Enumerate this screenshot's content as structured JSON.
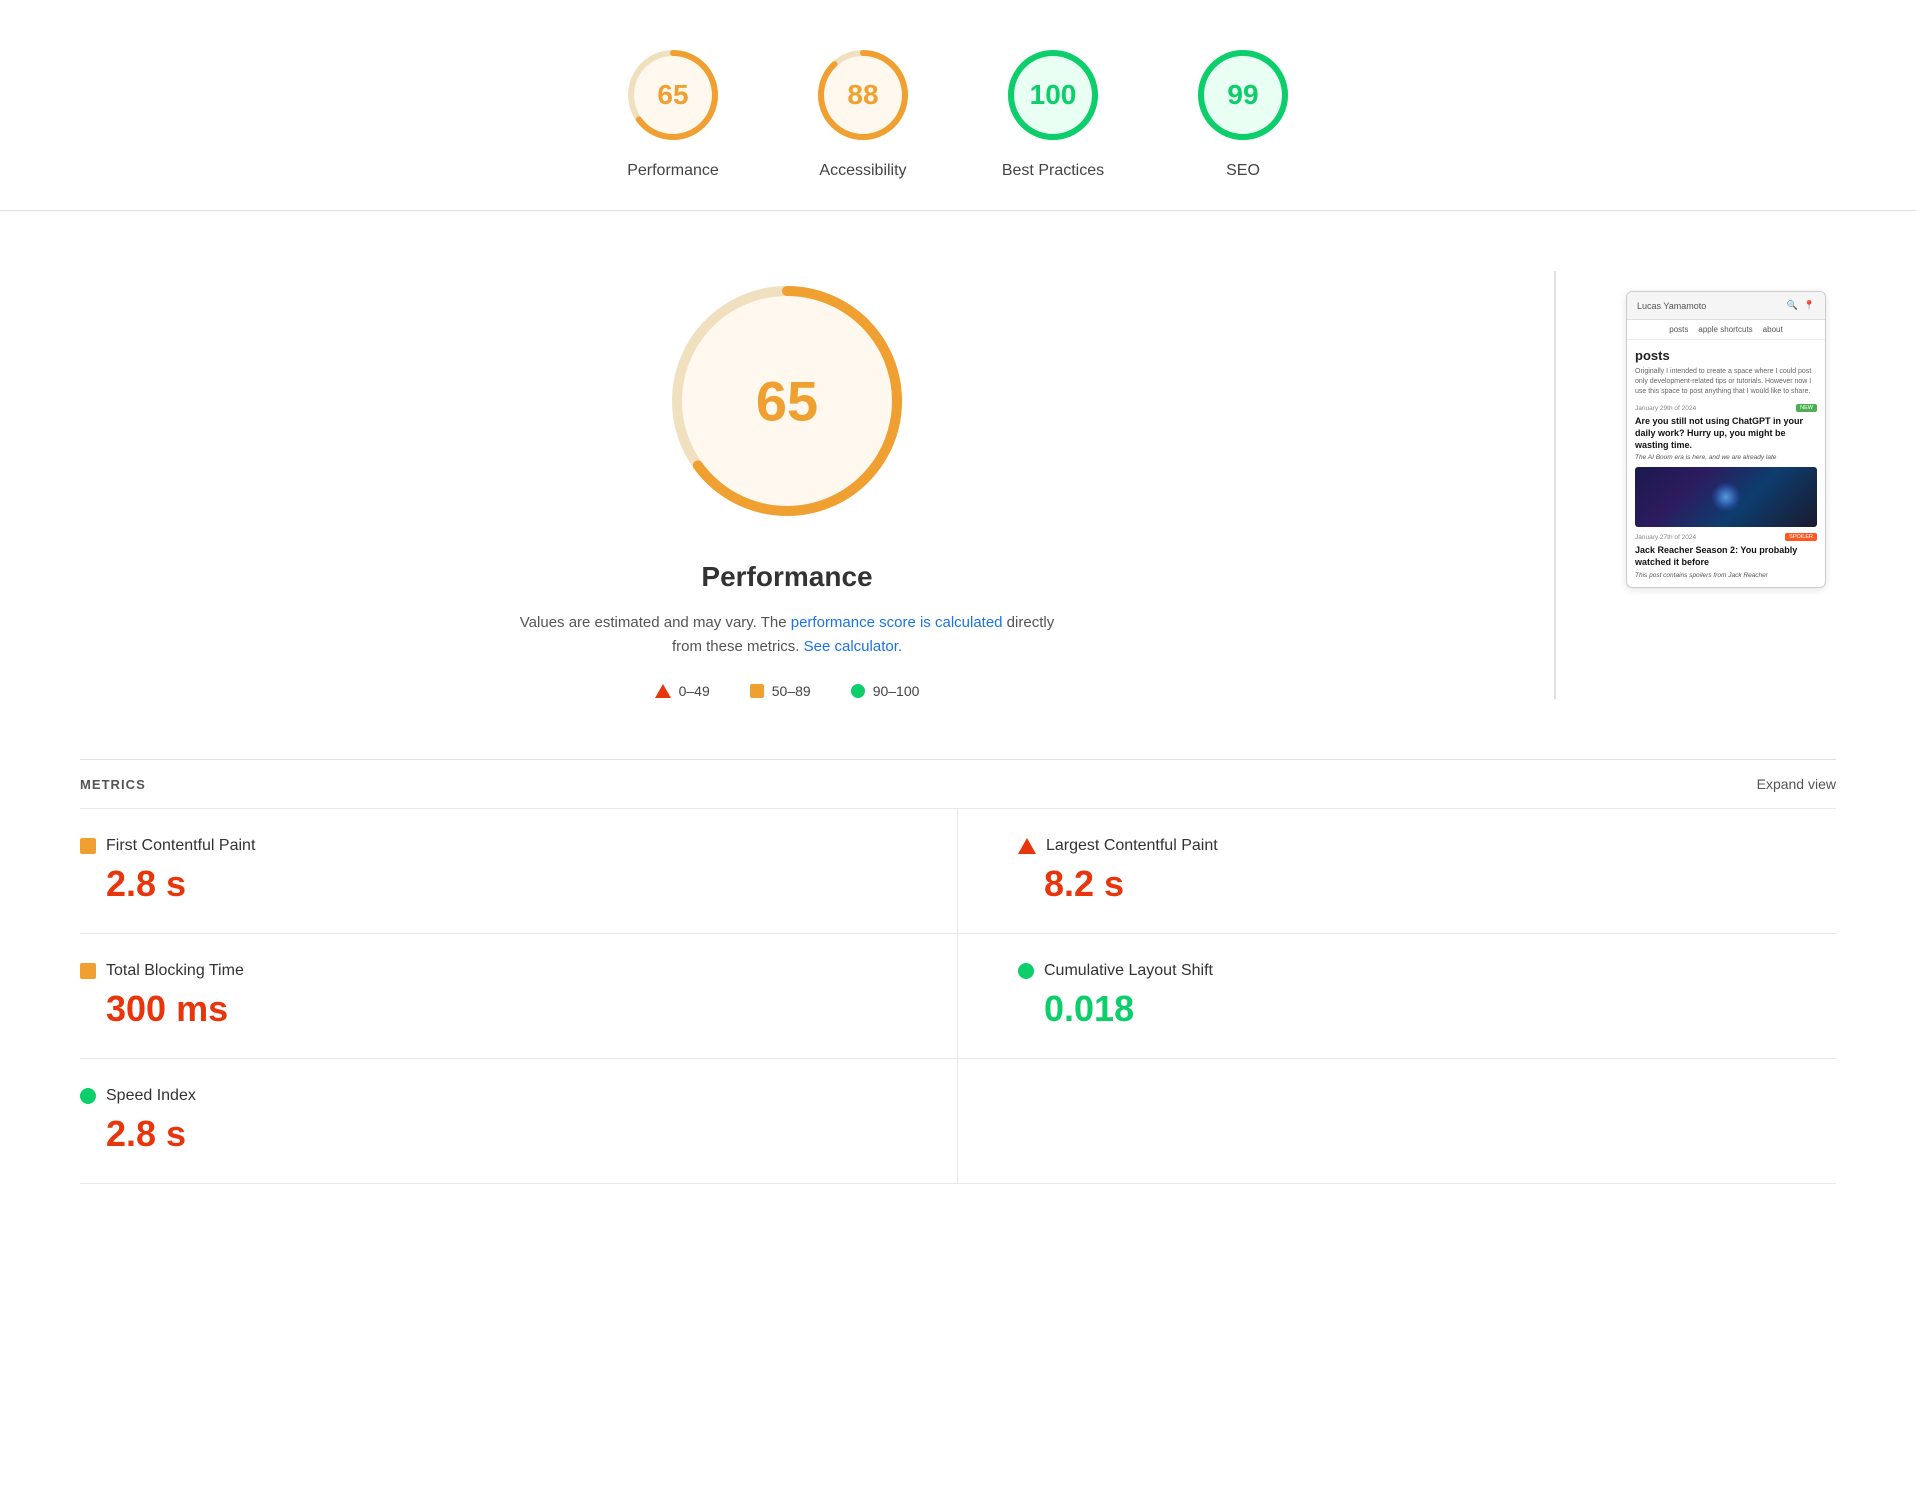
{
  "scores": [
    {
      "id": "performance",
      "value": 65,
      "label": "Performance",
      "color": "#f0a030",
      "ringColor": "#f0a030",
      "bgColor": "#fff8ee",
      "radius": 42,
      "circumference": 263.9,
      "dashOffset": 92.4
    },
    {
      "id": "accessibility",
      "value": 88,
      "label": "Accessibility",
      "color": "#f0a030",
      "ringColor": "#f0a030",
      "bgColor": "#fff8ee",
      "radius": 42,
      "circumference": 263.9,
      "dashOffset": 31.7
    },
    {
      "id": "best-practices",
      "value": 100,
      "label": "Best Practices",
      "color": "#0cce6b",
      "ringColor": "#0cce6b",
      "bgColor": "#eafff3",
      "radius": 42,
      "circumference": 263.9,
      "dashOffset": 0
    },
    {
      "id": "seo",
      "value": 99,
      "label": "SEO",
      "color": "#0cce6b",
      "ringColor": "#0cce6b",
      "bgColor": "#eafff3",
      "radius": 42,
      "circumference": 263.9,
      "dashOffset": 2.6
    }
  ],
  "big_score": {
    "value": "65",
    "title": "Performance",
    "desc_prefix": "Values are estimated and may vary. The ",
    "desc_link1": "performance score is calculated",
    "desc_middle": " directly from these metrics. ",
    "desc_link2": "See calculator.",
    "radius": 110,
    "circumference": 691.2,
    "dashOffset": 241.9
  },
  "legend": [
    {
      "type": "triangle",
      "range": "0–49"
    },
    {
      "type": "square",
      "range": "50–89"
    },
    {
      "type": "circle",
      "range": "90–100"
    }
  ],
  "metrics_label": "METRICS",
  "expand_label": "Expand view",
  "metrics": [
    {
      "name": "First Contentful Paint",
      "value": "2.8 s",
      "icon": "square",
      "color": "orange",
      "valueColor": "red"
    },
    {
      "name": "Largest Contentful Paint",
      "value": "8.2 s",
      "icon": "triangle",
      "color": "red",
      "valueColor": "red"
    },
    {
      "name": "Total Blocking Time",
      "value": "300 ms",
      "icon": "square",
      "color": "orange",
      "valueColor": "red"
    },
    {
      "name": "Cumulative Layout Shift",
      "value": "0.018",
      "icon": "circle",
      "color": "green",
      "valueColor": "green"
    },
    {
      "name": "Speed Index",
      "value": "2.8 s",
      "icon": "circle",
      "color": "green",
      "valueColor": "red"
    }
  ],
  "thumbnail": {
    "site_name": "Lucas Yamamoto",
    "nav_items": [
      "posts",
      "apple shortcuts",
      "about"
    ],
    "section_title": "posts",
    "section_desc": "Originally I intended to create a space where I could post only development-related tips or tutorials. However now I use this space to post anything that I would like to share.",
    "article1": {
      "date": "January 29th of 2024",
      "badge": "NEW",
      "title": "Are you still not using ChatGPT in your daily work? Hurry up, you might be wasting time.",
      "subtitle": "The AI Boom era is here, and we are already late"
    },
    "article2": {
      "date": "January 27th of 2024",
      "badge": "SPOILER",
      "title": "Jack Reacher Season 2: You probably watched it before",
      "subtitle": "This post contains spoilers from Jack Reacher"
    }
  }
}
